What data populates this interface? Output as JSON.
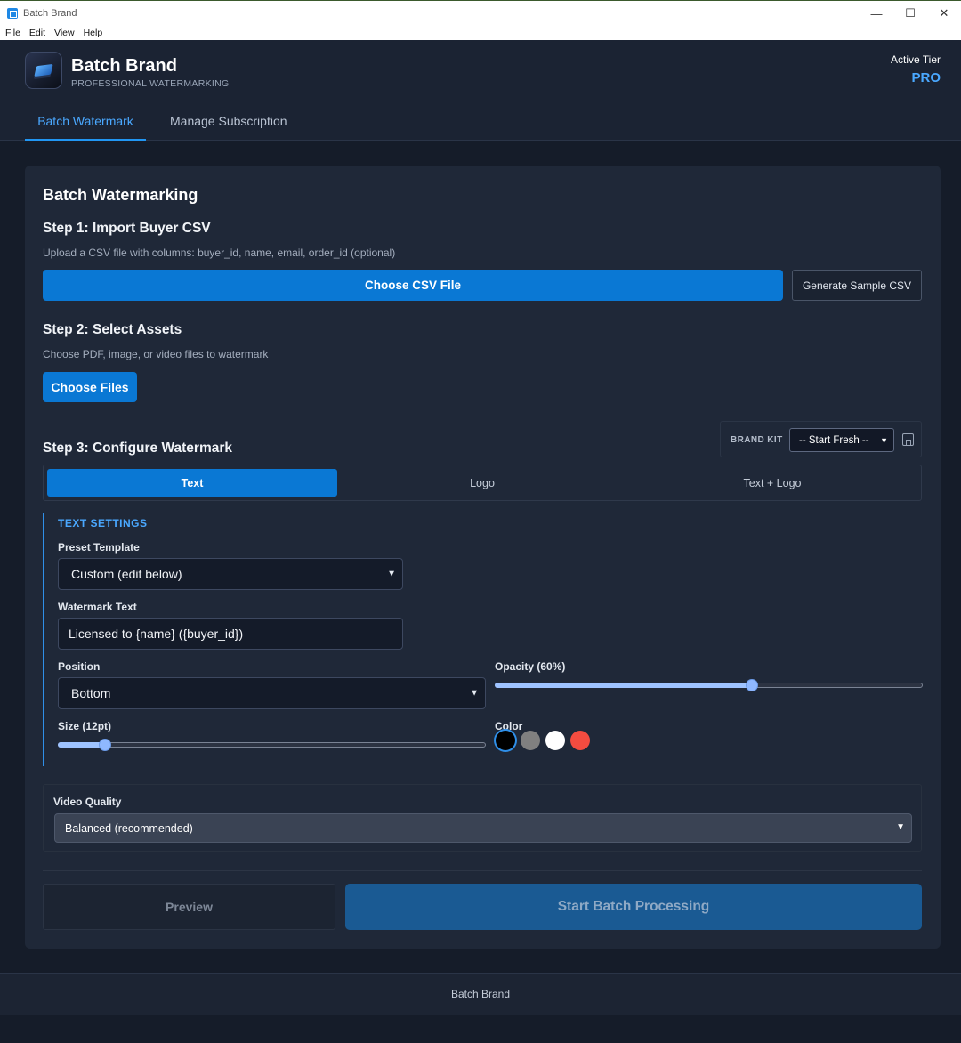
{
  "window": {
    "title": "Batch Brand",
    "controls": {
      "minimize": "—",
      "maximize": "☐",
      "close": "✕"
    }
  },
  "menu": [
    "File",
    "Edit",
    "View",
    "Help"
  ],
  "header": {
    "brand_name": "Batch Brand",
    "brand_sub": "PROFESSIONAL WATERMARKING",
    "tier_label": "Active Tier",
    "tier_value": "PRO",
    "tabs": [
      {
        "label": "Batch Watermark",
        "active": true
      },
      {
        "label": "Manage Subscription",
        "active": false
      }
    ]
  },
  "main": {
    "title": "Batch Watermarking",
    "step1": {
      "heading": "Step 1: Import Buyer CSV",
      "description": "Upload a CSV file with columns: buyer_id, name, email, order_id (optional)",
      "choose_csv": "Choose CSV File",
      "generate_sample": "Generate Sample CSV"
    },
    "step2": {
      "heading": "Step 2: Select Assets",
      "description": "Choose PDF, image, or video files to watermark",
      "choose_files": "Choose Files"
    },
    "step3": {
      "heading": "Step 3: Configure Watermark",
      "brand_kit_label": "BRAND KIT",
      "brand_kit_value": "-- Start Fresh --",
      "brand_kit_icon": "save-icon",
      "mode_tabs": [
        {
          "label": "Text",
          "active": true
        },
        {
          "label": "Logo",
          "active": false
        },
        {
          "label": "Text + Logo",
          "active": false
        }
      ],
      "text_settings": {
        "section_label": "TEXT SETTINGS",
        "preset_label": "Preset Template",
        "preset_value": "Custom (edit below)",
        "watermark_text_label": "Watermark Text",
        "watermark_text_value": "Licensed to {name} ({buyer_id})",
        "position_label": "Position",
        "position_value": "Bottom",
        "opacity_label": "Opacity (60%)",
        "opacity_value": 0.6,
        "size_label": "Size (12pt)",
        "size_fraction": 0.11,
        "color_label": "Color",
        "colors": [
          "#000000",
          "#808080",
          "#ffffff",
          "#f44c40"
        ],
        "selected_color": "#000000",
        "accent_color": "#2f8fe8"
      }
    },
    "video_quality": {
      "label": "Video Quality",
      "value": "Balanced (recommended)"
    },
    "actions": {
      "preview": "Preview",
      "start": "Start Batch Processing"
    }
  },
  "footer": {
    "text": "Batch Brand"
  }
}
